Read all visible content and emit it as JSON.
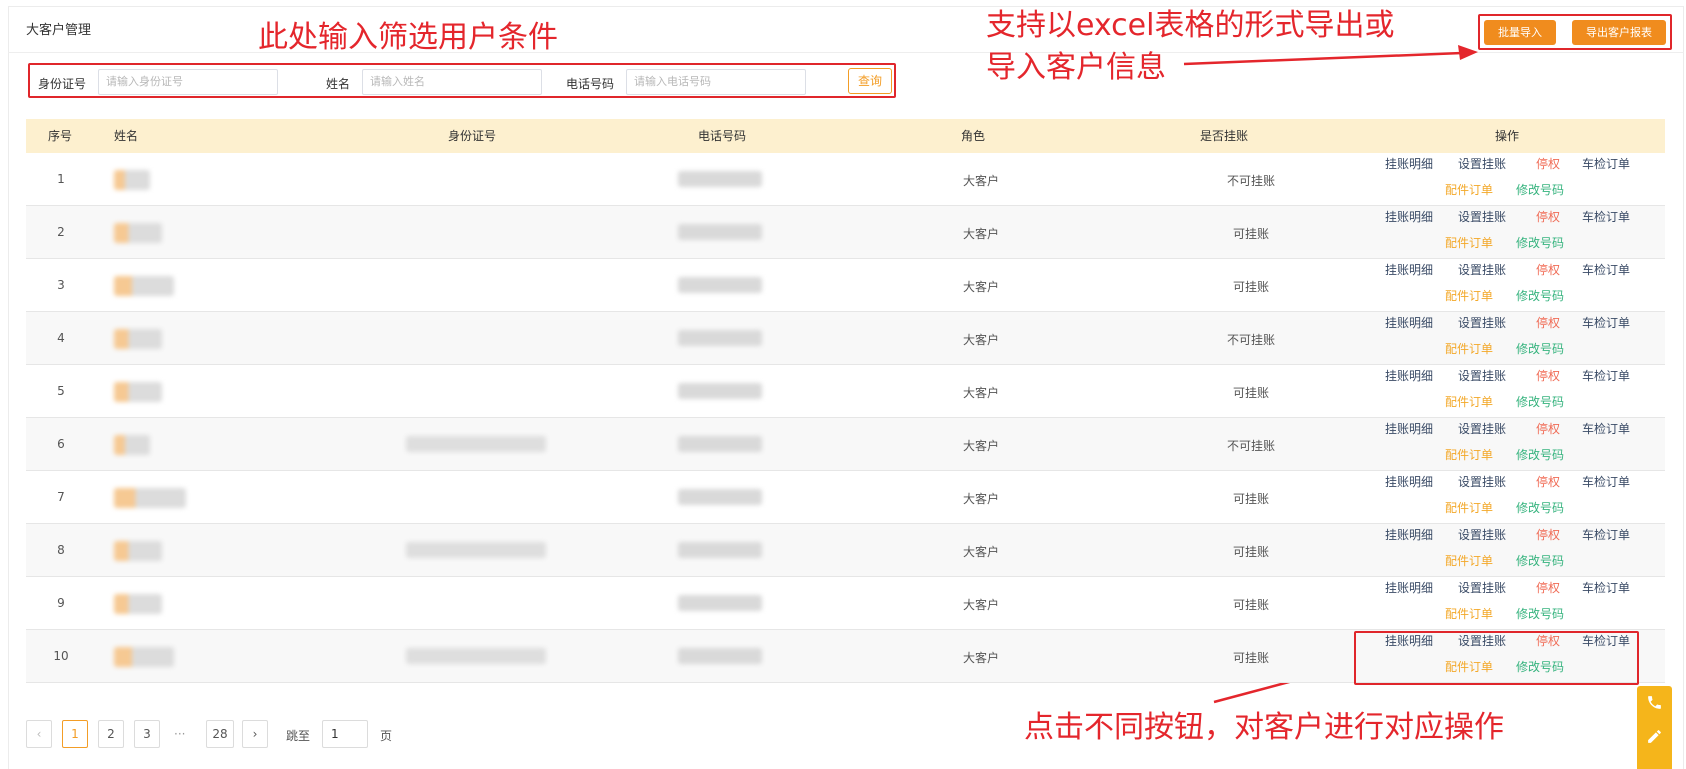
{
  "page": {
    "title": "大客户管理"
  },
  "filters": {
    "id_label": "身份证号",
    "id_placeholder": "请输入身份证号",
    "name_label": "姓名",
    "name_placeholder": "请输入姓名",
    "phone_label": "电话号码",
    "phone_placeholder": "请输入电话号码",
    "query_label": "查询"
  },
  "toolbar": {
    "import_label": "批量导入",
    "export_label": "导出客户报表"
  },
  "annotations": {
    "filter_note": "此处输入筛选用户条件",
    "export_note_line1": "支持以excel表格的形式导出或",
    "export_note_line2": "导入客户信息",
    "ops_note": "点击不同按钮，对客户进行对应操作"
  },
  "colors": {
    "accent": "#f08c1e",
    "header_bg": "#fdf0cf",
    "annotation_red": "#e4262c"
  },
  "table": {
    "headers": {
      "index": "序号",
      "name": "姓名",
      "id_no": "身份证号",
      "phone": "电话号码",
      "role": "角色",
      "credit": "是否挂账",
      "actions": "操作"
    },
    "actions": {
      "detail": "挂账明细",
      "set_credit": "设置挂账",
      "suspend": "停权",
      "inspection_orders": "车检订单",
      "parts_orders": "配件订单",
      "change_phone": "修改号码"
    },
    "rows": [
      {
        "index": "1",
        "role": "大客户",
        "credit": "不可挂账"
      },
      {
        "index": "2",
        "role": "大客户",
        "credit": "可挂账"
      },
      {
        "index": "3",
        "role": "大客户",
        "credit": "可挂账"
      },
      {
        "index": "4",
        "role": "大客户",
        "credit": "不可挂账"
      },
      {
        "index": "5",
        "role": "大客户",
        "credit": "可挂账"
      },
      {
        "index": "6",
        "role": "大客户",
        "credit": "不可挂账"
      },
      {
        "index": "7",
        "role": "大客户",
        "credit": "可挂账"
      },
      {
        "index": "8",
        "role": "大客户",
        "credit": "可挂账"
      },
      {
        "index": "9",
        "role": "大客户",
        "credit": "可挂账"
      },
      {
        "index": "10",
        "role": "大客户",
        "credit": "可挂账"
      }
    ]
  },
  "pagination": {
    "prev_icon": "chevron-left-icon",
    "pages": [
      "1",
      "2",
      "3"
    ],
    "ellipsis": "···",
    "last_page": "28",
    "next_icon": "chevron-right-icon",
    "jump_label": "跳至",
    "jump_value": "1",
    "page_suffix": "页"
  },
  "float_bar": {
    "icons": [
      "phone-icon",
      "edit-icon"
    ]
  }
}
